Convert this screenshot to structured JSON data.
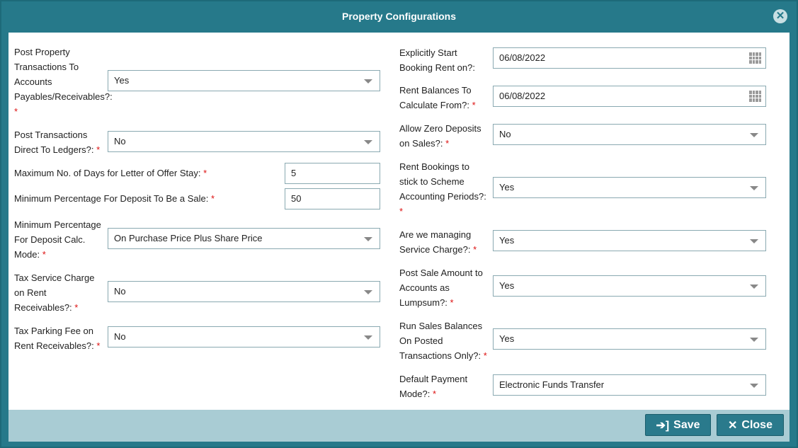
{
  "dialog": {
    "title": "Property Configurations"
  },
  "left": {
    "post_ap": {
      "label": "Post Property Transactions To Accounts Payables/Receivables?:",
      "value": "Yes"
    },
    "post_ledgers": {
      "label": "Post Transactions Direct To Ledgers?:",
      "value": "No"
    },
    "max_days": {
      "label": "Maximum No. of Days for Letter of Offer Stay:",
      "value": "5"
    },
    "min_pct_sale": {
      "label": "Minimum Percentage For Deposit To Be a Sale:",
      "value": "50"
    },
    "min_pct_mode": {
      "label": "Minimum Percentage For Deposit Calc. Mode:",
      "value": "On Purchase Price Plus Share Price"
    },
    "tax_service": {
      "label": "Tax Service Charge on Rent Receivables?:",
      "value": "No"
    },
    "tax_parking": {
      "label": "Tax Parking Fee on Rent Receivables?:",
      "value": "No"
    }
  },
  "right": {
    "start_rent": {
      "label": "Explicitly Start Booking Rent on?:",
      "value": "06/08/2022"
    },
    "rent_balances": {
      "label": "Rent Balances To Calculate From?:",
      "value": "06/08/2022"
    },
    "zero_deposits": {
      "label": "Allow Zero Deposits on Sales?:",
      "value": "No"
    },
    "scheme_periods": {
      "label": "Rent Bookings to stick to Scheme Accounting Periods?:",
      "value": "Yes"
    },
    "service_charge": {
      "label": "Are we managing Service Charge?:",
      "value": "Yes"
    },
    "lumpsum": {
      "label": "Post Sale Amount to Accounts as Lumpsum?:",
      "value": "Yes"
    },
    "sales_balances": {
      "label": "Run Sales Balances On Posted Transactions Only?:",
      "value": "Yes"
    },
    "payment_mode": {
      "label": "Default Payment Mode?:",
      "value": "Electronic Funds Transfer"
    }
  },
  "required_marker": "*",
  "footer": {
    "save_label": "Save",
    "close_label": "Close"
  }
}
